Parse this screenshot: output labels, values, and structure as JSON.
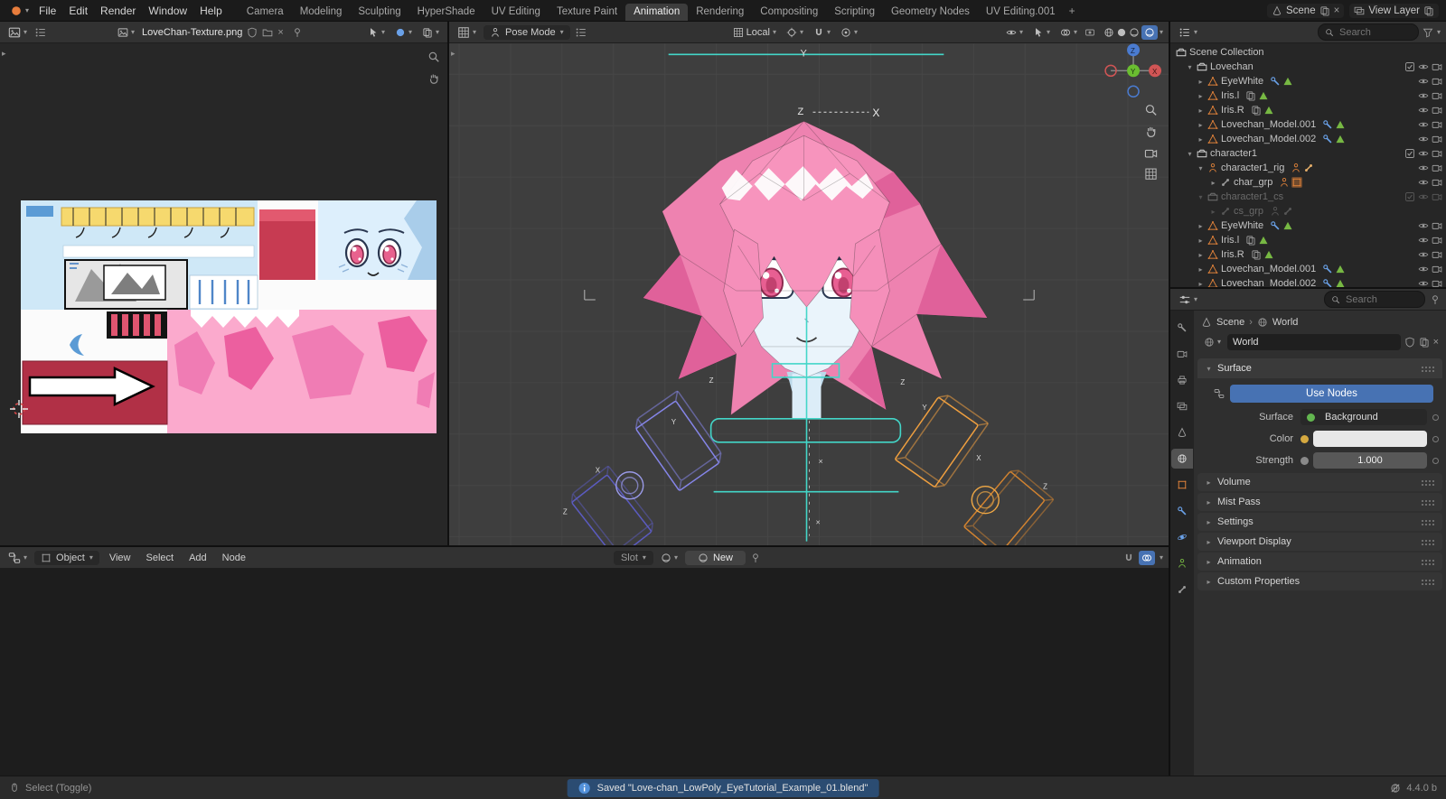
{
  "topbar": {
    "app_menu": [
      "File",
      "Edit",
      "Render",
      "Window",
      "Help"
    ],
    "workspaces": [
      "Camera",
      "Modeling",
      "Sculpting",
      "HyperShade",
      "UV Editing",
      "Texture Paint",
      "Animation",
      "Rendering",
      "Compositing",
      "Scripting",
      "Geometry Nodes",
      "UV Editing.001"
    ],
    "active_workspace": "Animation",
    "add_workspace": "+",
    "scene": "Scene",
    "view_layer": "View Layer"
  },
  "uv_editor": {
    "image_name": "LoveChan-Texture.png"
  },
  "viewport": {
    "mode": "Pose Mode",
    "orientation": "Local",
    "axis": {
      "x": "X",
      "y": "Y",
      "z": "Z"
    }
  },
  "shader_editor": {
    "shader_type": "Object",
    "menus": [
      "View",
      "Select",
      "Add",
      "Node"
    ],
    "slot": "Slot",
    "new_button": "New"
  },
  "outliner": {
    "search_placeholder": "Search",
    "rows": [
      {
        "name": "Scene Collection"
      },
      {
        "name": "Lovechan"
      },
      {
        "name": "EyeWhite"
      },
      {
        "name": "Iris.l"
      },
      {
        "name": "Iris.R"
      },
      {
        "name": "Lovechan_Model.001"
      },
      {
        "name": "Lovechan_Model.002"
      },
      {
        "name": "character1"
      },
      {
        "name": "character1_rig"
      },
      {
        "name": "char_grp"
      },
      {
        "name": "character1_cs"
      },
      {
        "name": "cs_grp"
      },
      {
        "name": "EyeWhite"
      },
      {
        "name": "Iris.l"
      },
      {
        "name": "Iris.R"
      },
      {
        "name": "Lovechan_Model.001"
      },
      {
        "name": "Lovechan_Model.002"
      }
    ]
  },
  "properties": {
    "search_placeholder": "Search",
    "breadcrumb": {
      "scene": "Scene",
      "world": "World"
    },
    "world_name": "World",
    "surface": {
      "title": "Surface",
      "use_nodes": "Use Nodes",
      "surface_label": "Surface",
      "surface_value": "Background",
      "color_label": "Color",
      "strength_label": "Strength",
      "strength_value": "1.000"
    },
    "collapsed_panels": [
      "Volume",
      "Mist Pass",
      "Settings",
      "Viewport Display",
      "Animation",
      "Custom Properties"
    ]
  },
  "statusbar": {
    "left": "Select (Toggle)",
    "message": "Saved \"Love-chan_LowPoly_EyeTutorial_Example_01.blend\"",
    "version": "4.4.0 b"
  },
  "icons": {
    "caret": "▾",
    "expand": "▸",
    "collapse": "▾",
    "close": "×",
    "sep": "›",
    "plus": "+"
  },
  "colors": {
    "accent": "#4772b3",
    "object_orange": "#e0823a",
    "data_green": "#77b843",
    "bone_unselected": "#8080e0",
    "bone_selected": "#ef9f3f",
    "control_teal": "#43d6c8"
  }
}
